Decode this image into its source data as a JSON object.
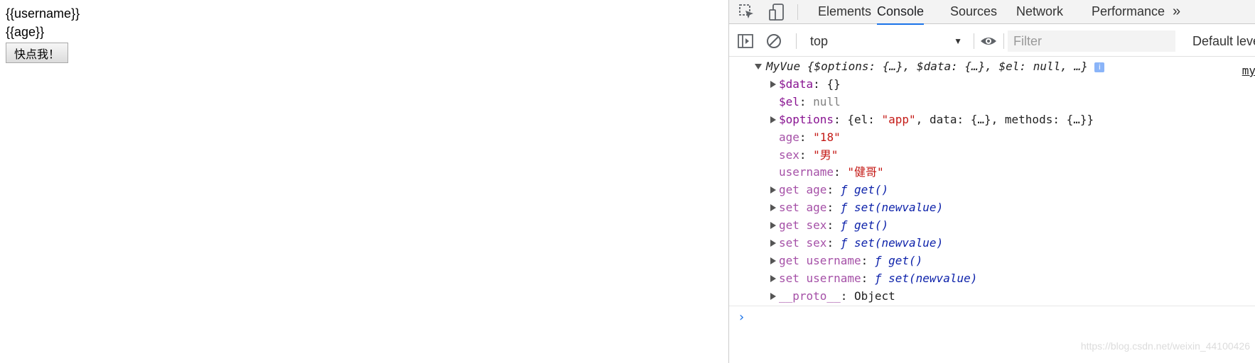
{
  "page": {
    "line1": "{{username}}",
    "line2": "{{age}}",
    "button_label": "快点我！"
  },
  "devtools": {
    "tabs": [
      "Elements",
      "Console",
      "Sources",
      "Network",
      "Performance"
    ],
    "active_tab": "Console",
    "more_tabs_icon": "»",
    "toolbar": {
      "context": "top",
      "filter_placeholder": "Filter",
      "levels": "Default levels ▼"
    },
    "icons": [
      "inspect-element-icon",
      "device-toolbar-icon",
      "sidebar-toggle-icon",
      "clear-console-icon",
      "eye-icon"
    ],
    "accent_color": "#1a73e8",
    "console": {
      "object_header": {
        "class_name": "MyVue",
        "preview": "{$options: {…}, $data: {…}, $el: null, …}",
        "info_badge": "i",
        "source": "my"
      },
      "props": [
        {
          "expand": true,
          "key": "$data",
          "key_color": "dark",
          "value": "{}"
        },
        {
          "expand": false,
          "key": "$el",
          "key_color": "dark",
          "value": "null",
          "value_type": "null"
        },
        {
          "expand": true,
          "key": "$options",
          "key_color": "dark",
          "value": "{el: \"app\", data: {…}, methods: {…}}",
          "value_type": "object"
        },
        {
          "expand": false,
          "key": "age",
          "key_color": "light",
          "value": "\"18\"",
          "value_type": "string"
        },
        {
          "expand": false,
          "key": "sex",
          "key_color": "light",
          "value": "\"男\"",
          "value_type": "string"
        },
        {
          "expand": false,
          "key": "username",
          "key_color": "light",
          "value": "\"健哥\"",
          "value_type": "string"
        },
        {
          "expand": true,
          "key": "get age",
          "key_color": "light",
          "value": "ƒ get()",
          "value_type": "function"
        },
        {
          "expand": true,
          "key": "set age",
          "key_color": "light",
          "value": "ƒ set(newvalue)",
          "value_type": "function"
        },
        {
          "expand": true,
          "key": "get sex",
          "key_color": "light",
          "value": "ƒ get()",
          "value_type": "function"
        },
        {
          "expand": true,
          "key": "set sex",
          "key_color": "light",
          "value": "ƒ set(newvalue)",
          "value_type": "function"
        },
        {
          "expand": true,
          "key": "get username",
          "key_color": "light",
          "value": "ƒ get()",
          "value_type": "function"
        },
        {
          "expand": true,
          "key": "set username",
          "key_color": "light",
          "value": "ƒ set(newvalue)",
          "value_type": "function"
        },
        {
          "expand": true,
          "key": "__proto__",
          "key_color": "light",
          "value": "Object",
          "value_type": "plain"
        }
      ],
      "prompt": "›"
    }
  },
  "watermark": "https://blog.csdn.net/weixin_44100426"
}
